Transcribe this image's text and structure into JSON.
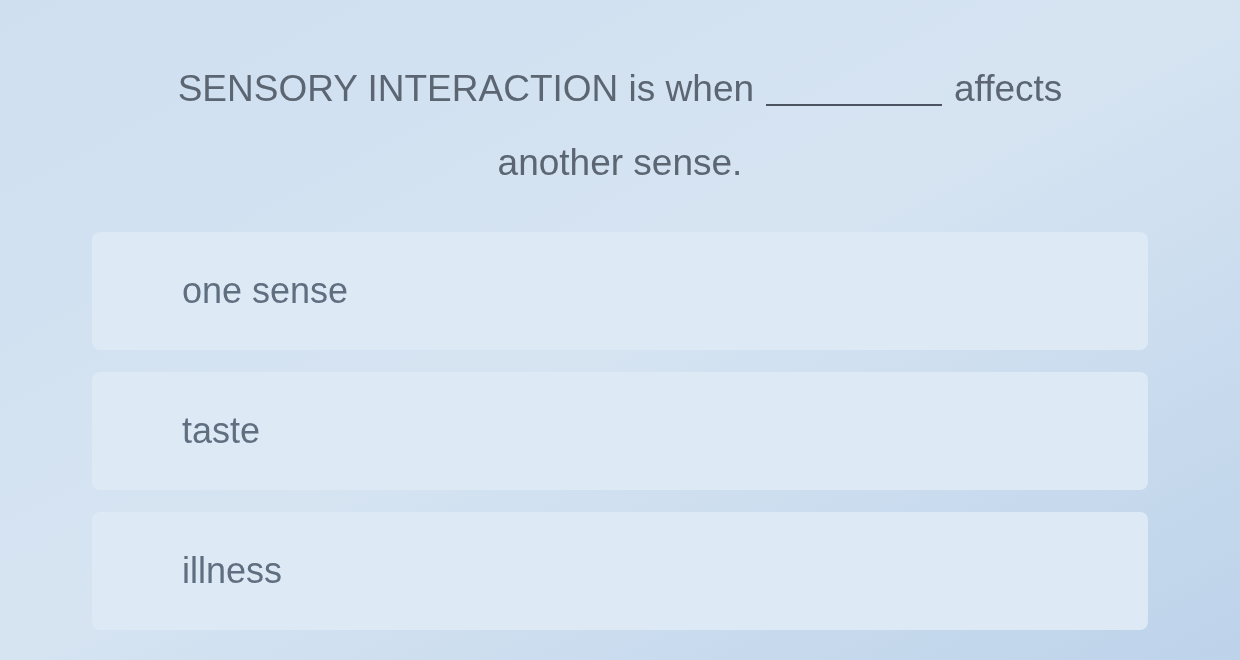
{
  "question": {
    "lines": [
      [
        {
          "kind": "text",
          "text": "SENSORY INTERACTION is when"
        },
        {
          "kind": "blank"
        },
        {
          "kind": "text",
          "text": "affects"
        }
      ],
      [
        {
          "kind": "text",
          "text": "another sense."
        }
      ]
    ]
  },
  "options": [
    {
      "label": "one sense",
      "selected": false
    },
    {
      "label": "taste",
      "selected": false
    },
    {
      "label": "illness",
      "selected": false
    }
  ]
}
